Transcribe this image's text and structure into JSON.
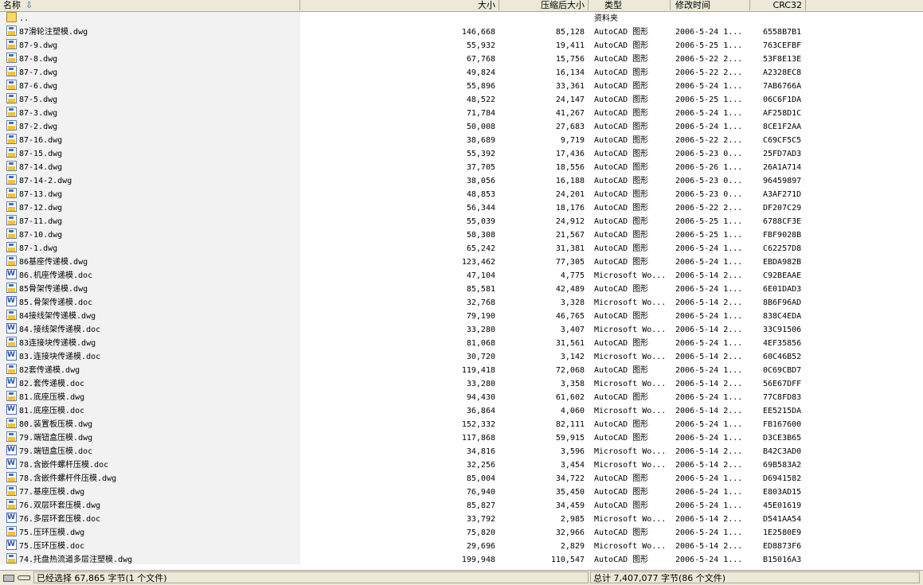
{
  "columns": {
    "name": "名称",
    "size": "大小",
    "packed": "压缩后大小",
    "type": "类型",
    "modified": "修改时间",
    "crc": "CRC32"
  },
  "files": [
    {
      "icon": "folder",
      "name": "..",
      "size": "",
      "packed": "",
      "type": "资料夹",
      "modified": "",
      "crc": ""
    },
    {
      "icon": "dwg",
      "name": "87滑轮注塑模.dwg",
      "size": "146,668",
      "packed": "85,128",
      "type": "AutoCAD 图形",
      "modified": "2006-5-24 1...",
      "crc": "6558B7B1"
    },
    {
      "icon": "dwg",
      "name": "87-9.dwg",
      "size": "55,932",
      "packed": "19,411",
      "type": "AutoCAD 图形",
      "modified": "2006-5-25 1...",
      "crc": "763CEFBF"
    },
    {
      "icon": "dwg",
      "name": "87-8.dwg",
      "size": "67,768",
      "packed": "15,756",
      "type": "AutoCAD 图形",
      "modified": "2006-5-22 2...",
      "crc": "53F8E13E"
    },
    {
      "icon": "dwg",
      "name": "87-7.dwg",
      "size": "49,824",
      "packed": "16,134",
      "type": "AutoCAD 图形",
      "modified": "2006-5-22 2...",
      "crc": "A2328EC8"
    },
    {
      "icon": "dwg",
      "name": "87-6.dwg",
      "size": "55,896",
      "packed": "33,361",
      "type": "AutoCAD 图形",
      "modified": "2006-5-24 1...",
      "crc": "7AB6766A"
    },
    {
      "icon": "dwg",
      "name": "87-5.dwg",
      "size": "48,522",
      "packed": "24,147",
      "type": "AutoCAD 图形",
      "modified": "2006-5-25 1...",
      "crc": "06C6F1DA"
    },
    {
      "icon": "dwg",
      "name": "87-3.dwg",
      "size": "71,784",
      "packed": "41,267",
      "type": "AutoCAD 图形",
      "modified": "2006-5-24 1...",
      "crc": "AF258D1C"
    },
    {
      "icon": "dwg",
      "name": "87-2.dwg",
      "size": "50,008",
      "packed": "27,683",
      "type": "AutoCAD 图形",
      "modified": "2006-5-24 1...",
      "crc": "8CE1F2AA"
    },
    {
      "icon": "dwg",
      "name": "87-16.dwg",
      "size": "38,689",
      "packed": "9,719",
      "type": "AutoCAD 图形",
      "modified": "2006-5-22 2...",
      "crc": "C69CF5C5"
    },
    {
      "icon": "dwg",
      "name": "87-15.dwg",
      "size": "55,392",
      "packed": "17,436",
      "type": "AutoCAD 图形",
      "modified": "2006-5-23 0...",
      "crc": "25FD7AD3"
    },
    {
      "icon": "dwg",
      "name": "87-14.dwg",
      "size": "37,705",
      "packed": "18,556",
      "type": "AutoCAD 图形",
      "modified": "2006-5-26 1...",
      "crc": "26A1A714"
    },
    {
      "icon": "dwg",
      "name": "87-14-2.dwg",
      "size": "38,056",
      "packed": "16,188",
      "type": "AutoCAD 图形",
      "modified": "2006-5-23 0...",
      "crc": "96459897"
    },
    {
      "icon": "dwg",
      "name": "87-13.dwg",
      "size": "48,853",
      "packed": "24,201",
      "type": "AutoCAD 图形",
      "modified": "2006-5-23 0...",
      "crc": "A3AF271D"
    },
    {
      "icon": "dwg",
      "name": "87-12.dwg",
      "size": "56,344",
      "packed": "18,176",
      "type": "AutoCAD 图形",
      "modified": "2006-5-22 2...",
      "crc": "DF207C29"
    },
    {
      "icon": "dwg",
      "name": "87-11.dwg",
      "size": "55,039",
      "packed": "24,912",
      "type": "AutoCAD 图形",
      "modified": "2006-5-25 1...",
      "crc": "6788CF3E"
    },
    {
      "icon": "dwg",
      "name": "87-10.dwg",
      "size": "58,308",
      "packed": "21,567",
      "type": "AutoCAD 图形",
      "modified": "2006-5-25 1...",
      "crc": "FBF9028B"
    },
    {
      "icon": "dwg",
      "name": "87-1.dwg",
      "size": "65,242",
      "packed": "31,381",
      "type": "AutoCAD 图形",
      "modified": "2006-5-24 1...",
      "crc": "C62257D8"
    },
    {
      "icon": "dwg",
      "name": "86基座传递模.dwg",
      "size": "123,462",
      "packed": "77,305",
      "type": "AutoCAD 图形",
      "modified": "2006-5-24 1...",
      "crc": "EBDA982B"
    },
    {
      "icon": "doc",
      "name": "86.机座传递模.doc",
      "size": "47,104",
      "packed": "4,775",
      "type": "Microsoft Wo...",
      "modified": "2006-5-14 2...",
      "crc": "C92BEAAE"
    },
    {
      "icon": "dwg",
      "name": "85骨架传递模.dwg",
      "size": "85,581",
      "packed": "42,489",
      "type": "AutoCAD 图形",
      "modified": "2006-5-24 1...",
      "crc": "6E01DAD3"
    },
    {
      "icon": "doc",
      "name": "85.骨架传递模.doc",
      "size": "32,768",
      "packed": "3,328",
      "type": "Microsoft Wo...",
      "modified": "2006-5-14 2...",
      "crc": "8B6F96AD"
    },
    {
      "icon": "dwg",
      "name": "84接线架传递模.dwg",
      "size": "79,190",
      "packed": "46,765",
      "type": "AutoCAD 图形",
      "modified": "2006-5-24 1...",
      "crc": "838C4EDA"
    },
    {
      "icon": "doc",
      "name": "84.接线架传递模.doc",
      "size": "33,280",
      "packed": "3,407",
      "type": "Microsoft Wo...",
      "modified": "2006-5-14 2...",
      "crc": "33C91506"
    },
    {
      "icon": "dwg",
      "name": "83连接块传递模.dwg",
      "size": "81,068",
      "packed": "31,561",
      "type": "AutoCAD 图形",
      "modified": "2006-5-24 1...",
      "crc": "4EF35856"
    },
    {
      "icon": "doc",
      "name": "83.连接块传递模.doc",
      "size": "30,720",
      "packed": "3,142",
      "type": "Microsoft Wo...",
      "modified": "2006-5-14 2...",
      "crc": "60C46B52"
    },
    {
      "icon": "dwg",
      "name": "82套传递模.dwg",
      "size": "119,418",
      "packed": "72,068",
      "type": "AutoCAD 图形",
      "modified": "2006-5-24 1...",
      "crc": "0C69CBD7"
    },
    {
      "icon": "doc",
      "name": "82.套传递模.doc",
      "size": "33,280",
      "packed": "3,358",
      "type": "Microsoft Wo...",
      "modified": "2006-5-14 2...",
      "crc": "56E67DFF"
    },
    {
      "icon": "dwg",
      "name": "81.底座压模.dwg",
      "size": "94,430",
      "packed": "61,602",
      "type": "AutoCAD 图形",
      "modified": "2006-5-24 1...",
      "crc": "77C8FD83"
    },
    {
      "icon": "doc",
      "name": "81.底座压模.doc",
      "size": "36,864",
      "packed": "4,060",
      "type": "Microsoft Wo...",
      "modified": "2006-5-14 2...",
      "crc": "EE5215DA"
    },
    {
      "icon": "dwg",
      "name": "80.装置板压模.dwg",
      "size": "152,332",
      "packed": "82,111",
      "type": "AutoCAD 图形",
      "modified": "2006-5-24 1...",
      "crc": "FB167600"
    },
    {
      "icon": "dwg",
      "name": "79.端钮盒压模.dwg",
      "size": "117,868",
      "packed": "59,915",
      "type": "AutoCAD 图形",
      "modified": "2006-5-24 1...",
      "crc": "D3CE3B65"
    },
    {
      "icon": "doc",
      "name": "79.端钮盒压模.doc",
      "size": "34,816",
      "packed": "3,596",
      "type": "Microsoft Wo...",
      "modified": "2006-5-14 2...",
      "crc": "B42C3AD0"
    },
    {
      "icon": "doc",
      "name": "78.含嵌件螺杆压模.doc",
      "size": "32,256",
      "packed": "3,454",
      "type": "Microsoft Wo...",
      "modified": "2006-5-14 2...",
      "crc": "69B583A2"
    },
    {
      "icon": "dwg",
      "name": "78.含嵌件螺杆件压模.dwg",
      "size": "85,004",
      "packed": "34,722",
      "type": "AutoCAD 图形",
      "modified": "2006-5-24 1...",
      "crc": "D6941582"
    },
    {
      "icon": "dwg",
      "name": "77.基座压模.dwg",
      "size": "76,940",
      "packed": "35,450",
      "type": "AutoCAD 图形",
      "modified": "2006-5-24 1...",
      "crc": "E803AD15"
    },
    {
      "icon": "dwg",
      "name": "76.双层环套压模.dwg",
      "size": "85,827",
      "packed": "34,459",
      "type": "AutoCAD 图形",
      "modified": "2006-5-24 1...",
      "crc": "45E01619"
    },
    {
      "icon": "doc",
      "name": "76.多层环套压模.doc",
      "size": "33,792",
      "packed": "2,985",
      "type": "Microsoft Wo...",
      "modified": "2006-5-14 2...",
      "crc": "D541AA54"
    },
    {
      "icon": "dwg",
      "name": "75.压环压模.dwg",
      "size": "75,820",
      "packed": "32,966",
      "type": "AutoCAD 图形",
      "modified": "2006-5-24 1...",
      "crc": "1E2580E9"
    },
    {
      "icon": "doc",
      "name": "75.压环压模.doc",
      "size": "29,696",
      "packed": "2,829",
      "type": "Microsoft Wo...",
      "modified": "2006-5-14 2...",
      "crc": "ED8873F6"
    },
    {
      "icon": "dwg",
      "name": "74.托盘热流道多层注塑模.dwg",
      "size": "199,948",
      "packed": "110,547",
      "type": "AutoCAD 图形",
      "modified": "2006-5-24 1...",
      "crc": "B15016A3"
    }
  ],
  "status": {
    "selected": "已经选择 67,865 字节(1 个文件)",
    "total": "总计 7,407,077 字节(86 个文件)"
  },
  "icons": {
    "sort": "sort-descending-icon",
    "status_left": [
      "disk-icon",
      "key-icon"
    ]
  }
}
